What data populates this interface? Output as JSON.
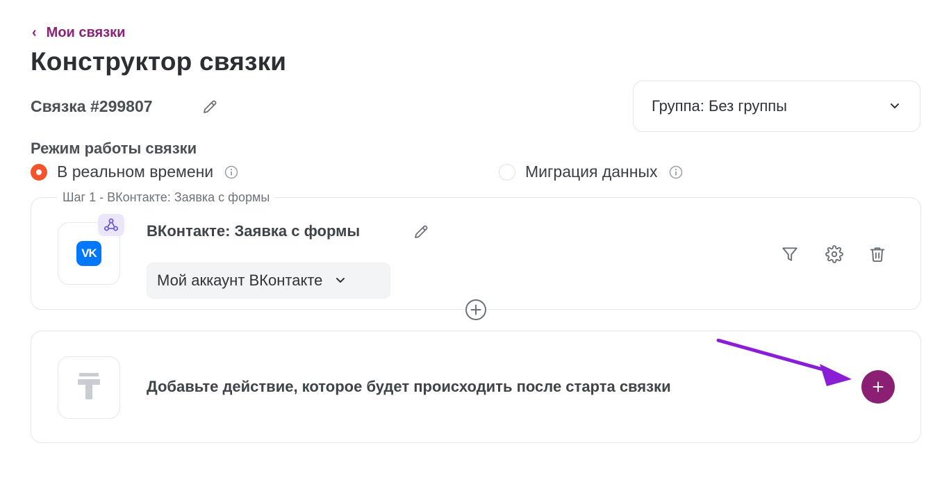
{
  "nav": {
    "back_label": "Мои связки"
  },
  "page": {
    "title": "Конструктор связки"
  },
  "link": {
    "name": "Связка #299807"
  },
  "group": {
    "label": "Группа: Без группы"
  },
  "mode": {
    "title": "Режим работы связки",
    "options": [
      {
        "label": "В реальном времени",
        "selected": true
      },
      {
        "label": "Миграция данных",
        "selected": false
      }
    ]
  },
  "step1": {
    "legend": "Шаг 1 - ВКонтакте: Заявка с формы",
    "service_logo_text": "VK",
    "name": "ВКонтакте: Заявка с формы",
    "account": "Мой аккаунт ВКонтакте"
  },
  "action": {
    "prompt": "Добавьте действие, которое будет происходить после старта связки"
  },
  "colors": {
    "accent": "#8b1f73",
    "radio_active": "#f2542d",
    "vk_blue": "#0077ff",
    "annotation_arrow": "#8a1ed6"
  }
}
